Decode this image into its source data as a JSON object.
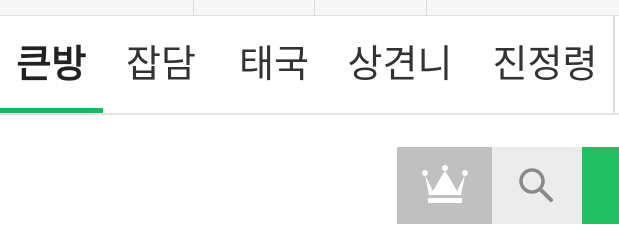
{
  "tabs": [
    {
      "label": "큰방",
      "active": true
    },
    {
      "label": "잡담",
      "active": false
    },
    {
      "label": "태국",
      "active": false
    },
    {
      "label": "상견니",
      "active": false
    },
    {
      "label": "진정령",
      "active": false
    }
  ],
  "toolbar": {
    "buttons": [
      {
        "icon": "crown-icon",
        "bg": "#c0c0c0"
      },
      {
        "icon": "search-icon",
        "bg": "#ececec"
      },
      {
        "icon": "action-button",
        "bg": "#21c063"
      }
    ]
  },
  "colors": {
    "accent": "#21b361",
    "tab_text": "#333333"
  }
}
